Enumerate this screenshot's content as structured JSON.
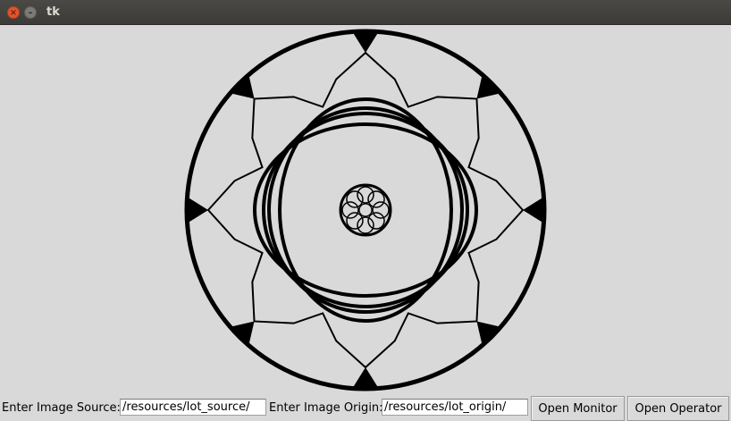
{
  "window": {
    "title": "tk",
    "close_icon": "close-icon",
    "minimize_icon": "minimize-icon"
  },
  "form": {
    "source_label": "Enter Image Source:",
    "source_value": "/resources/lot_source/",
    "origin_label": "Enter Image Origin:",
    "origin_value": "/resources/lot_origin/",
    "open_monitor_label": "Open Monitor",
    "open_operator_label": "Open Operator"
  },
  "drawing": {
    "description_icon": "mandala-pattern",
    "stroke_color": "#000000",
    "background_color": "#d9d9d9",
    "outer_markers": 8,
    "star_points": 8,
    "inner_circles": 4,
    "rosette_petals": 8
  }
}
